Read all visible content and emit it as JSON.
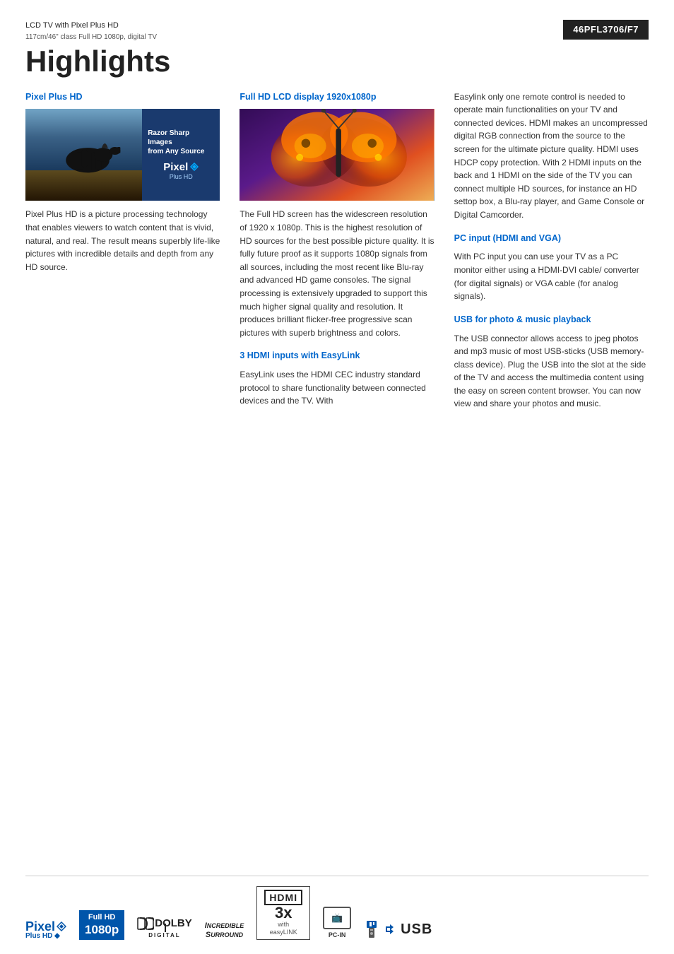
{
  "header": {
    "product_title": "LCD TV with Pixel Plus HD",
    "product_subtitle": "117cm/46\" class Full HD 1080p, digital TV",
    "model_number": "46PFL3706/F7"
  },
  "page_title": "Highlights",
  "sections": {
    "pixel_plus_hd": {
      "title": "Pixel Plus HD",
      "image_text_line1": "Razor Sharp Images",
      "image_text_line2": "from Any Source",
      "logo_text": "Pixel",
      "logo_sub": "Plus HD",
      "body": "Pixel Plus HD is a picture processing technology that enables viewers to watch content that is vivid, natural, and real. The result means superbly life-like pictures with incredible details and depth from any HD source."
    },
    "full_hd": {
      "title": "Full HD LCD display 1920x1080p",
      "body": "The Full HD screen has the widescreen resolution of 1920 x 1080p. This is the highest resolution of HD sources for the best possible picture quality. It is fully future proof as it supports 1080p signals from all sources, including the most recent like Blu-ray and advanced HD game consoles. The signal processing is extensively upgraded to support this much higher signal quality and resolution. It produces brilliant flicker-free progressive scan pictures with superb brightness and colors."
    },
    "hdmi": {
      "title": "3 HDMI inputs with EasyLink",
      "body": "EasyLink uses the HDMI CEC industry standard protocol to share functionality between connected devices and the TV. With Easylink only one remote control is needed to operate main functionalities on your TV and connected devices. HDMI makes an uncompressed digital RGB connection from the source to the screen for the ultimate picture quality. HDMI uses HDCP copy protection. With 2 HDMI inputs on the back and 1 HDMI on the side of the TV you can connect multiple HD sources, for instance an HD settop box, a Blu-ray player, and Game Console or Digital Camcorder."
    },
    "pc_input": {
      "title": "PC input (HDMI and VGA)",
      "body": "With PC input you can use your TV as a PC monitor either using a HDMI-DVI cable/ converter (for digital signals) or VGA cable (for analog signals)."
    },
    "usb": {
      "title": "USB for photo & music playback",
      "body": "The USB connector allows access to jpeg photos and mp3 music of most USB-sticks (USB memory-class device). Plug the USB into the slot at the side of the TV and access the multimedia content using the easy on screen content browser. You can now view and share your photos and music."
    }
  },
  "footer_badges": [
    {
      "id": "pixel-plus-hd",
      "label": "Pixel Plus HD"
    },
    {
      "id": "full-hd-1080p",
      "label": "Full HD 1080p"
    },
    {
      "id": "dolby-digital",
      "label": "Dolby Digital"
    },
    {
      "id": "incredible-surround",
      "label": "Incredible Surround"
    },
    {
      "id": "hdmi-3x",
      "label": "HDMI 3x with EasyLink"
    },
    {
      "id": "pc-in",
      "label": "PC-IN"
    },
    {
      "id": "usb",
      "label": "USB"
    }
  ]
}
